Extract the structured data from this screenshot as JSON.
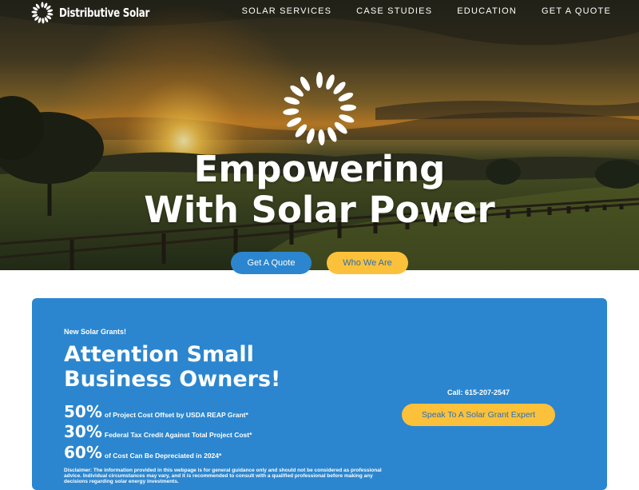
{
  "brand": {
    "name": "Distributive Solar"
  },
  "nav": {
    "items": [
      "SOLAR SERVICES",
      "CASE STUDIES",
      "EDUCATION",
      "GET A QUOTE"
    ]
  },
  "hero": {
    "headline_line1": "Empowering",
    "headline_line2": "With Solar Power",
    "primary_button": "Get A Quote",
    "secondary_button": "Who We Are"
  },
  "grant": {
    "kicker": "New Solar Grants!",
    "title_line1": "Attention Small",
    "title_line2": "Business Owners!",
    "stats": [
      {
        "pct": "50%",
        "text": "of Project Cost Offset by USDA REAP Grant*"
      },
      {
        "pct": "30%",
        "text": "Federal Tax Credit Against Total Project Cost*"
      },
      {
        "pct": "60%",
        "text": "of Cost Can Be Depreciated in 2024*"
      }
    ],
    "disclaimer": "Disclaimer: The information provided in this webpage is for general guidance only and should not be considered as professional advice. Individual circumstances may vary, and it is recommended to consult with a qualified professional before making any decisions regarding solar energy investments.",
    "call": "Call: 615-207-2547",
    "cta": "Speak To A Solar Grant Expert"
  },
  "colors": {
    "primary_blue": "#2b86cf",
    "accent_yellow": "#fbc13a",
    "link_blue": "#2b6fb7",
    "white": "#ffffff"
  },
  "icons": {
    "logo": "sun-rays-icon",
    "hero": "sun-rays-icon"
  }
}
